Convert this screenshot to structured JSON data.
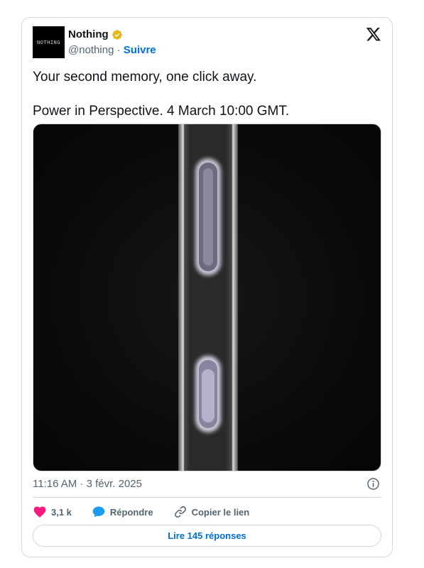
{
  "account": {
    "avatar_text": "NOTHING",
    "name": "Nothing",
    "handle": "@nothing",
    "separator": "·",
    "follow_label": "Suivre"
  },
  "tweet": {
    "text_line_1": "Your second memory, one click away.",
    "text_line_2": "Power in Perspective. 4 March 10:00 GMT.",
    "timestamp": "11:16 AM · 3 févr. 2025"
  },
  "actions": {
    "likes_count": "3,1 k",
    "reply_label": "Répondre",
    "copy_link_label": "Copier le lien"
  },
  "read_replies_label": "Lire 145 réponses",
  "colors": {
    "accent_blue": "#006fd6",
    "like_pink": "#f91880",
    "reply_blue": "#1d9bf0",
    "verified_gold": "#e2b719",
    "muted_text": "#536471",
    "border": "#cfd9de"
  },
  "icons": {
    "verified": "verified-badge-icon",
    "brand": "x-logo-icon",
    "info": "info-icon",
    "like": "heart-icon",
    "reply": "speech-bubble-icon",
    "copy_link": "link-icon"
  }
}
